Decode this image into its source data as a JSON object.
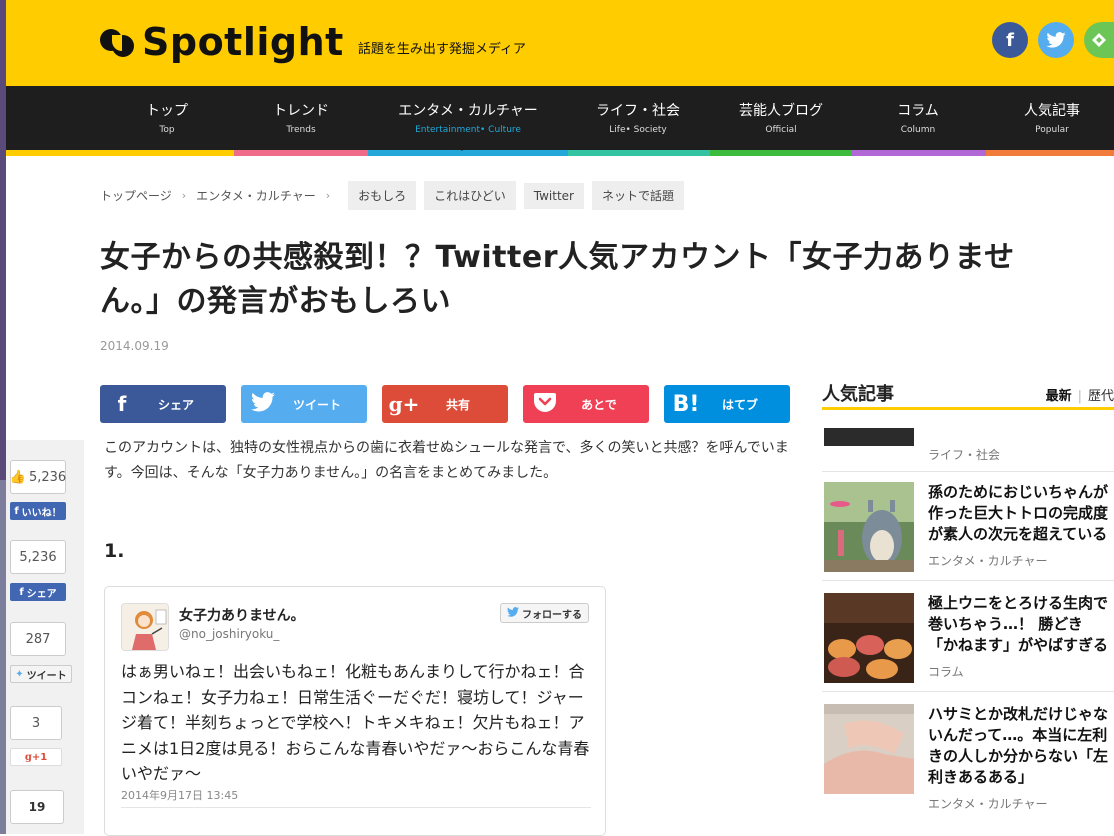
{
  "site": {
    "logo": "Spotlight",
    "tagline": "話題を生み出す発掘メディア",
    "social_icons": [
      "facebook-icon",
      "twitter-icon",
      "feedly-icon"
    ]
  },
  "nav": {
    "items": [
      {
        "jp": "トップ",
        "en": "Top"
      },
      {
        "jp": "トレンド",
        "en": "Trends"
      },
      {
        "jp": "エンタメ・カルチャー",
        "en": "Entertainment• Culture"
      },
      {
        "jp": "ライフ・社会",
        "en": "Life• Society"
      },
      {
        "jp": "芸能人ブログ",
        "en": "Official"
      },
      {
        "jp": "コラム",
        "en": "Column"
      },
      {
        "jp": "人気記事",
        "en": "Popular"
      }
    ],
    "active": "エンタメ・カルチャー",
    "strip_colors": [
      "#ffcc00",
      "#f06b8a",
      "#23a8d9",
      "#34c3a0",
      "#3dbb3d",
      "#b267d6",
      "#f07b3b"
    ]
  },
  "breadcrumb": {
    "home": "トップページ",
    "category": "エンタメ・カルチャー",
    "tags": [
      "おもしろ",
      "これはひどい",
      "Twitter",
      "ネットで話題"
    ]
  },
  "article": {
    "title_line1": "女子からの共感殺到！？Twitter人気アカウント「女子力ありませ",
    "title_line2": "ん。」の発言がおもしろい",
    "date": "2014.09.19",
    "intro": "このアカウントは、独特の女性視点からの歯に衣着せぬシュールな発言で、多くの笑いと共感？を呼んでいます。今回は、そんな「女子力ありません。」の名言をまとめてみました。",
    "section_number": "1."
  },
  "share_buttons": [
    {
      "icon": "f",
      "label": "シェア",
      "color": "#3b5998"
    },
    {
      "icon": "t",
      "label": "ツイート",
      "color": "#55acee"
    },
    {
      "icon": "g+",
      "label": "共有",
      "color": "#dd4b39"
    },
    {
      "icon": "pocket",
      "label": "あとで",
      "color": "#ef4056"
    },
    {
      "icon": "B!",
      "label": "はてブ",
      "color": "#008fde"
    }
  ],
  "tweet": {
    "name": "女子力ありません。",
    "handle": "@no_joshiryoku_",
    "follow_label": "フォローする",
    "text": "はぁ男いねェ！出会いもねェ！化粧もあんまりして行かねェ！合コンねェ！女子力ねェ！日常生活ぐーだぐだ！寝坊して！ジャージ着て！半刻ちょっとで学校へ！トキメキねェ！欠片もねェ！アニメは1日2度は見る！おらこんな青春いやだァ〜おらこんな青春いやだァ〜",
    "time": "2014年9月17日 13:45"
  },
  "float_share": {
    "fb_like_count": "5,236",
    "fb_like_label": "いいね！",
    "fb_share_count": "5,236",
    "fb_share_label": "シェア",
    "tweet_count": "287",
    "tweet_label": "ツイート",
    "gplus_count": "3",
    "gplus_label": "+1",
    "hatena_count": "19"
  },
  "sidebar": {
    "title": "人気記事",
    "tab_active": "最新",
    "tab_other": "歴代",
    "articles": [
      {
        "title": "",
        "category": "ライフ・社会"
      },
      {
        "title_lines": [
          "孫のためにおじいちゃんが",
          "作った巨大トトロの完成度",
          "が素人の次元を超えている"
        ],
        "category": "エンタメ・カルチャー"
      },
      {
        "title_lines": [
          "極上ウニをとろける生肉で",
          "巻いちゃう…！ 勝どき",
          "「かねます」がやばすぎる"
        ],
        "category": "コラム"
      },
      {
        "title_lines": [
          "ハサミとか改札だけじゃな",
          "いんだって…。本当に左利",
          "きの人しか分からない「左",
          "利きあるある」"
        ],
        "category": "エンタメ・カルチャー"
      }
    ]
  }
}
